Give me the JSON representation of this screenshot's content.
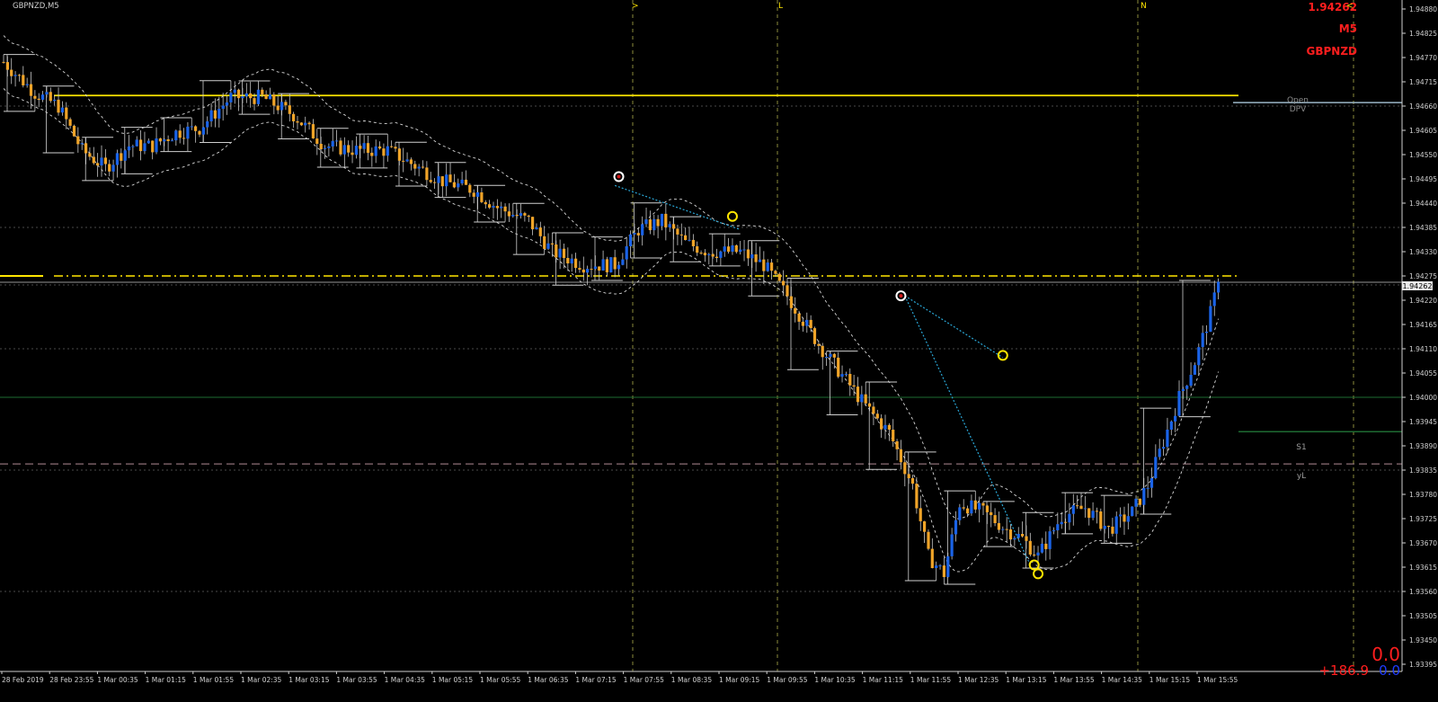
{
  "chart_title": "GBPNZD,M5",
  "info_panel": {
    "price": "1.94262",
    "timeframe": "M5",
    "symbol": "GBPNZD"
  },
  "bottom_info": {
    "value_top": "0.0",
    "value_left": "+186.9",
    "value_right": "0.0"
  },
  "colors": {
    "background": "#000000",
    "bull_candle": "#1a63e8",
    "bear_candle": "#f0a428",
    "wick": "#c8c8c8",
    "yellow_level": "#ffe600",
    "red_text": "#ff1e1e",
    "blue_text": "#1e3cff",
    "grid": "#4a4a4a",
    "green_level": "#1e6b32",
    "pink_level": "#b08a94",
    "open_line": "#9bb7c8",
    "trend_line": "#2aa8d8",
    "envelope": "#d8d8d8",
    "session_line": "#8c8c3c"
  },
  "session_markers": [
    ">",
    "L",
    "N",
    "<"
  ],
  "level_labels": {
    "open": "Open",
    "dpv": "DPV",
    "s1": "S1",
    "yl": "yL"
  },
  "chart_data": {
    "type": "candlestick",
    "symbol": "GBPNZD",
    "timeframe": "M5",
    "current_price": 1.94262,
    "y_ticks": [
      1.93395,
      1.9345,
      1.93505,
      1.9356,
      1.93615,
      1.9367,
      1.93725,
      1.9378,
      1.93835,
      1.9389,
      1.93945,
      1.94,
      1.94055,
      1.9411,
      1.94165,
      1.9422,
      1.94275,
      1.9433,
      1.94385,
      1.9444,
      1.94495,
      1.9455,
      1.94605,
      1.9466,
      1.94715,
      1.9477,
      1.94825,
      1.9488
    ],
    "y_tick_labels": [
      "1.93395",
      "1.93450",
      "1.93505",
      "1.93560",
      "1.93615",
      "1.93670",
      "1.93725",
      "1.93780",
      "1.93835",
      "1.93890",
      "1.93945",
      "1.94000",
      "1.94055",
      "1.94110",
      "1.94165",
      "1.94220",
      "1.94275",
      "1.94330",
      "1.94385",
      "1.94440",
      "1.94495",
      "1.94550",
      "1.94605",
      "1.94660",
      "1.94715",
      "1.94770",
      "1.94825",
      "1.94880"
    ],
    "x_tick_labels": [
      "28 Feb 2019",
      "28 Feb 23:55",
      "1 Mar 00:35",
      "1 Mar 01:15",
      "1 Mar 01:55",
      "1 Mar 02:35",
      "1 Mar 03:15",
      "1 Mar 03:55",
      "1 Mar 04:35",
      "1 Mar 05:15",
      "1 Mar 05:55",
      "1 Mar 06:35",
      "1 Mar 07:15",
      "1 Mar 07:55",
      "1 Mar 08:35",
      "1 Mar 09:15",
      "1 Mar 09:55",
      "1 Mar 10:35",
      "1 Mar 11:15",
      "1 Mar 11:55",
      "1 Mar 12:35",
      "1 Mar 13:15",
      "1 Mar 13:55",
      "1 Mar 14:35",
      "1 Mar 15:15",
      "1 Mar 15:55"
    ],
    "key_levels": {
      "yellow_top": 1.94684,
      "yellow_current": 1.94275,
      "open": 1.94668,
      "green": 1.94,
      "s1": 1.93922,
      "yl": 1.93849
    },
    "anchors": [
      [
        0,
        1.9476
      ],
      [
        8,
        1.9469
      ],
      [
        14,
        1.9466
      ],
      [
        20,
        1.9456
      ],
      [
        26,
        1.9452
      ],
      [
        32,
        1.9457
      ],
      [
        38,
        1.9457
      ],
      [
        44,
        1.946
      ],
      [
        50,
        1.9461
      ],
      [
        58,
        1.9468
      ],
      [
        66,
        1.9468
      ],
      [
        74,
        1.9464
      ],
      [
        82,
        1.9457
      ],
      [
        90,
        1.9456
      ],
      [
        98,
        1.9456
      ],
      [
        106,
        1.9452
      ],
      [
        112,
        1.9449
      ],
      [
        120,
        1.9447
      ],
      [
        126,
        1.9443
      ],
      [
        134,
        1.944
      ],
      [
        140,
        1.9433
      ],
      [
        148,
        1.943
      ],
      [
        156,
        1.943
      ],
      [
        162,
        1.9438
      ],
      [
        168,
        1.944
      ],
      [
        174,
        1.9435
      ],
      [
        180,
        1.9433
      ],
      [
        188,
        1.9433
      ],
      [
        194,
        1.943
      ],
      [
        200,
        1.9423
      ],
      [
        208,
        1.9412
      ],
      [
        214,
        1.9405
      ],
      [
        220,
        1.9398
      ],
      [
        226,
        1.9392
      ],
      [
        232,
        1.938
      ],
      [
        236,
        1.9364
      ],
      [
        240,
        1.936
      ],
      [
        244,
        1.9376
      ],
      [
        250,
        1.9374
      ],
      [
        256,
        1.937
      ],
      [
        260,
        1.9368
      ],
      [
        264,
        1.9364
      ],
      [
        270,
        1.9373
      ],
      [
        276,
        1.9375
      ],
      [
        282,
        1.937
      ],
      [
        288,
        1.9374
      ],
      [
        292,
        1.938
      ],
      [
        296,
        1.939
      ],
      [
        300,
        1.94
      ],
      [
        304,
        1.9408
      ],
      [
        308,
        1.9419
      ],
      [
        310,
        1.9426
      ]
    ]
  }
}
